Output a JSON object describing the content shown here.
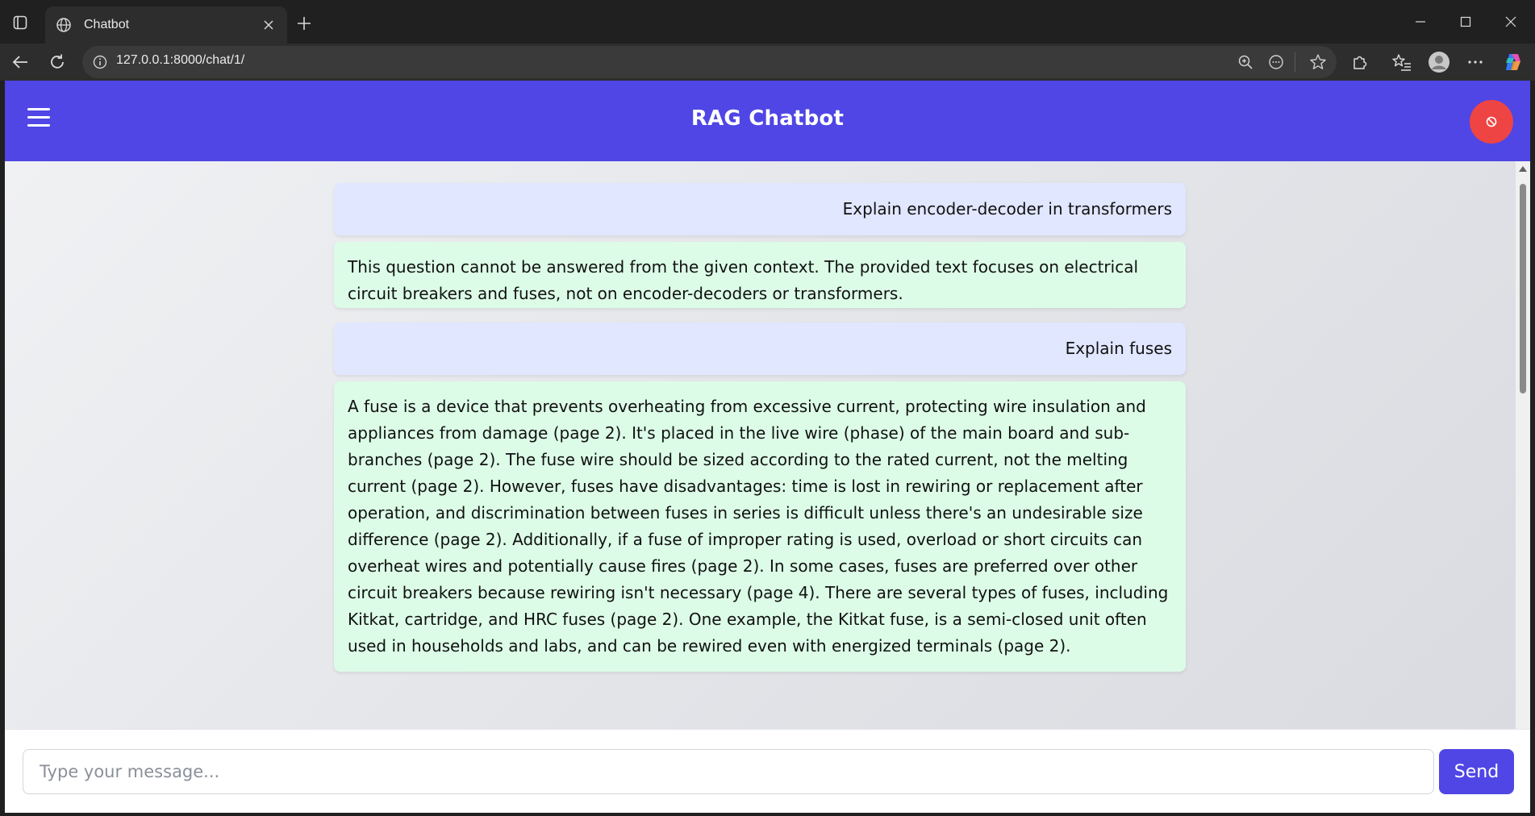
{
  "browser": {
    "tab_title": "Chatbot",
    "url": "127.0.0.1:8000/chat/1/"
  },
  "header": {
    "title": "RAG Chatbot",
    "colors": {
      "header_bg": "#4f46e5",
      "clear_button": "#ef4444"
    }
  },
  "messages": [
    {
      "role": "user",
      "text": "Explain encoder-decoder in transformers"
    },
    {
      "role": "bot",
      "text": "This question cannot be answered from the given context. The provided text focuses on electrical circuit breakers and fuses, not on encoder-decoders or transformers."
    },
    {
      "role": "user",
      "text": "Explain fuses"
    },
    {
      "role": "bot",
      "text": "A fuse is a device that prevents overheating from excessive current, protecting wire insulation and appliances from damage (page 2). It's placed in the live wire (phase) of the main board and sub-branches (page 2). The fuse wire should be sized according to the rated current, not the melting current (page 2). However, fuses have disadvantages: time is lost in rewiring or replacement after operation, and discrimination between fuses in series is difficult unless there's an undesirable size difference (page 2). Additionally, if a fuse of improper rating is used, overload or short circuits can overheat wires and potentially cause fires (page 2). In some cases, fuses are preferred over other circuit breakers because rewiring isn't necessary (page 4). There are several types of fuses, including Kitkat, cartridge, and HRC fuses (page 2). One example, the Kitkat fuse, is a semi-closed unit often used in households and labs, and can be rewired even with energized terminals (page 2)."
    }
  ],
  "input": {
    "placeholder": "Type your message...",
    "value": "",
    "send_label": "Send"
  },
  "colors": {
    "user_bubble": "#e0e7ff",
    "bot_bubble": "#dcfce7",
    "accent": "#4f46e5"
  }
}
